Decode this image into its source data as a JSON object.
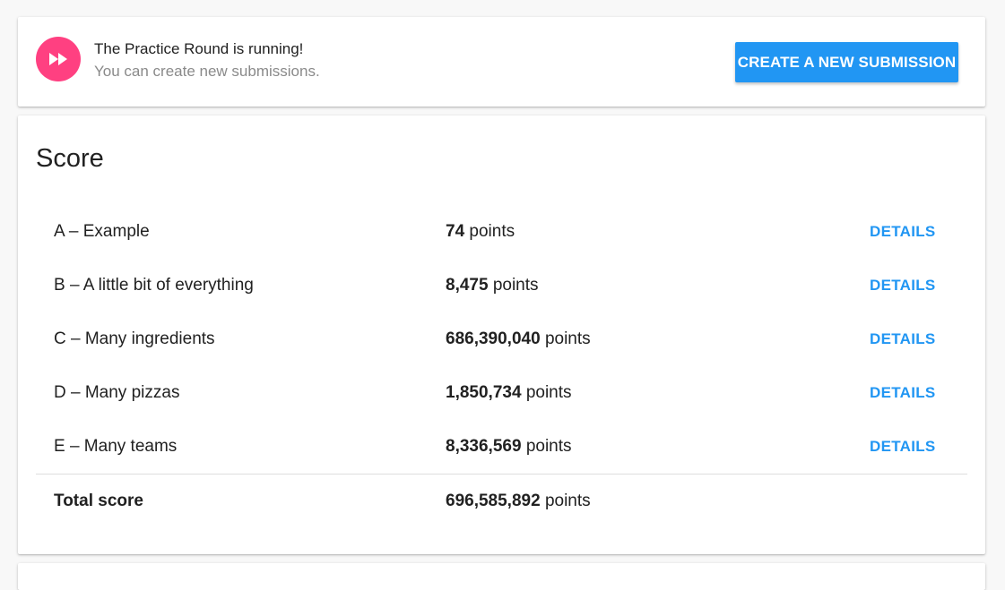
{
  "status": {
    "icon": "fast-forward-icon",
    "icon_color": "#ff4081",
    "title": "The Practice Round is running!",
    "subtitle": "You can create new submissions.",
    "create_button_label": "CREATE A NEW SUBMISSION",
    "button_color": "#2196f3"
  },
  "score": {
    "title": "Score",
    "unit": "points",
    "details_label": "DETAILS",
    "rows": [
      {
        "name": "A – Example",
        "points": "74"
      },
      {
        "name": "B – A little bit of everything",
        "points": "8,475"
      },
      {
        "name": "C – Many ingredients",
        "points": "686,390,040"
      },
      {
        "name": "D – Many pizzas",
        "points": "1,850,734"
      },
      {
        "name": "E – Many teams",
        "points": "8,336,569"
      }
    ],
    "total": {
      "name": "Total score",
      "points": "696,585,892"
    }
  }
}
